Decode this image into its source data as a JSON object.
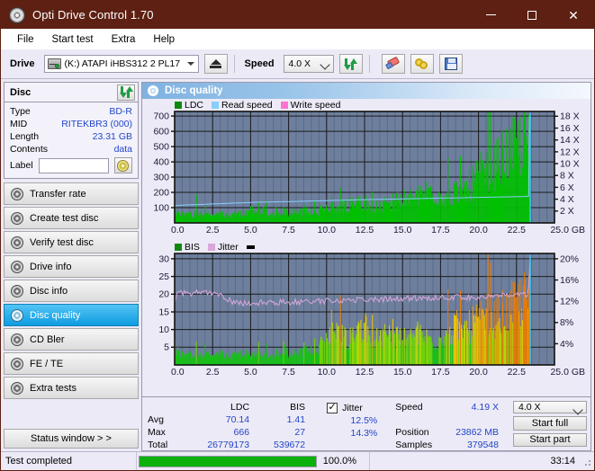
{
  "window": {
    "title": "Opti Drive Control 1.70",
    "icon": "disc-icon",
    "minimize_label": "—",
    "maximize_label": "□",
    "close_label": "✕"
  },
  "menu": {
    "items": [
      {
        "label": "File"
      },
      {
        "label": "Start test"
      },
      {
        "label": "Extra"
      },
      {
        "label": "Help"
      }
    ]
  },
  "toolbar": {
    "drive_label": "Drive",
    "drive_value": "(K:)  ATAPI iHBS312   2 PL17",
    "eject_icon": "eject-icon",
    "speed_label": "Speed",
    "speed_value": "4.0 X",
    "refresh_icon": "refresh-icon",
    "eraser_icon": "eraser-icon",
    "rings_icon": "gold-rings-icon",
    "save_icon": "floppy-save-icon"
  },
  "disc_panel": {
    "title": "Disc",
    "refresh_icon": "refresh-icon",
    "rows": [
      {
        "key": "Type",
        "value": "BD-R"
      },
      {
        "key": "MID",
        "value": "RITEKBR3 (000)"
      },
      {
        "key": "Length",
        "value": "23.31 GB"
      },
      {
        "key": "Contents",
        "value": "data"
      }
    ],
    "label_key": "Label",
    "label_value": "",
    "label_placeholder": "",
    "label_button_icon": "cd-disc-icon"
  },
  "nav": {
    "items": [
      {
        "label": "Transfer rate",
        "icon": "disc-icon",
        "active": false
      },
      {
        "label": "Create test disc",
        "icon": "disc-icon",
        "active": false
      },
      {
        "label": "Verify test disc",
        "icon": "disc-icon",
        "active": false
      },
      {
        "label": "Drive info",
        "icon": "disc-icon",
        "active": false
      },
      {
        "label": "Disc info",
        "icon": "disc-icon",
        "active": false
      },
      {
        "label": "Disc quality",
        "icon": "disc-icon",
        "active": true
      },
      {
        "label": "CD Bler",
        "icon": "disc-icon",
        "active": false
      },
      {
        "label": "FE / TE",
        "icon": "disc-icon",
        "active": false
      },
      {
        "label": "Extra tests",
        "icon": "disc-icon",
        "active": false
      }
    ],
    "status_window_label": "Status window > >"
  },
  "panel": {
    "title": "Disc quality",
    "icon": "disc-icon"
  },
  "stats": {
    "col_headers": [
      "LDC",
      "BIS"
    ],
    "rows": [
      {
        "label": "Avg",
        "ldc": "70.14",
        "bis": "1.41",
        "jitter": "12.5%"
      },
      {
        "label": "Max",
        "ldc": "666",
        "bis": "27",
        "jitter": "14.3%"
      },
      {
        "label": "Total",
        "ldc": "26779173",
        "bis": "539672",
        "jitter": ""
      }
    ],
    "jitter_label": "Jitter",
    "jitter_checked": true,
    "speed_label": "Speed",
    "speed_value": "4.19 X",
    "position_label": "Position",
    "position_value": "23862 MB",
    "samples_label": "Samples",
    "samples_value": "379548",
    "speed_select_value": "4.0 X",
    "start_full_label": "Start full",
    "start_part_label": "Start part"
  },
  "statusbar": {
    "message": "Test completed",
    "percent_label": "100.0%",
    "percent_value": 100,
    "time": "33:14"
  },
  "colors": {
    "titlebar": "#5d2012",
    "accent_blue": "#2346c8",
    "plot_bg": "#6e7f9e",
    "ldc_green": "#00c000",
    "read_speed": "#87cefa",
    "write_speed": "#ff70d0",
    "bis_green": "#00c000",
    "jitter_pink": "#d9a8d9",
    "progress_green": "#0bb00b",
    "nav_active": "#0e9ce0"
  },
  "chart_data": [
    {
      "type": "area",
      "name": "ldc-chart",
      "title": "",
      "xlabel": "GB",
      "ylabel": "",
      "xlim": [
        0,
        25
      ],
      "xticks": [
        "0.0",
        "2.5",
        "5.0",
        "7.5",
        "10.0",
        "12.5",
        "15.0",
        "17.5",
        "20.0",
        "22.5",
        "25.0 GB"
      ],
      "ylim": [
        0,
        730
      ],
      "yticks": [
        100,
        200,
        300,
        400,
        500,
        600,
        700
      ],
      "y2label": "X",
      "y2lim": [
        0,
        18.8
      ],
      "y2ticks": [
        "2 X",
        "4 X",
        "6 X",
        "8 X",
        "10 X",
        "12 X",
        "14 X",
        "16 X",
        "18 X"
      ],
      "grid": true,
      "legend": [
        "LDC",
        "Read speed",
        "Write speed"
      ],
      "legend_position": "top-left",
      "data_end_x": 23.4,
      "series": [
        {
          "name": "LDC",
          "color": "#00c000",
          "kind": "area",
          "x": [
            0.0,
            0.15,
            0.3,
            0.6,
            0.9,
            1.2,
            1.35,
            1.5,
            1.8,
            2.1,
            2.4,
            2.7,
            3.0,
            3.3,
            3.6,
            3.9,
            4.2,
            4.5,
            4.8,
            4.97,
            5.0,
            5.05,
            5.3,
            5.6,
            5.8,
            5.95,
            6.1,
            6.4,
            6.7,
            7.0,
            7.3,
            7.6,
            7.9,
            8.2,
            8.5,
            8.8,
            9.1,
            9.4,
            9.7,
            10.0,
            10.3,
            10.6,
            10.9,
            11.2,
            11.5,
            11.8,
            11.95,
            12.2,
            12.5,
            12.8,
            13.1,
            13.4,
            13.7,
            14.0,
            14.3,
            14.6,
            14.9,
            15.2,
            15.5,
            15.8,
            16.1,
            16.4,
            16.7,
            16.85,
            17.0,
            17.3,
            17.6,
            17.9,
            18.2,
            18.5,
            18.8,
            19.1,
            19.4,
            19.7,
            20.0,
            20.3,
            20.6,
            20.9,
            21.2,
            21.5,
            21.8,
            22.1,
            22.4,
            22.7,
            23.0,
            23.2,
            23.35,
            23.4
          ],
          "values": [
            130,
            75,
            62,
            70,
            66,
            64,
            118,
            72,
            68,
            64,
            66,
            62,
            68,
            64,
            70,
            66,
            72,
            68,
            74,
            120,
            290,
            110,
            78,
            80,
            140,
            86,
            82,
            80,
            78,
            82,
            80,
            84,
            82,
            86,
            88,
            92,
            96,
            100,
            104,
            108,
            112,
            118,
            126,
            132,
            140,
            152,
            168,
            150,
            158,
            150,
            146,
            150,
            152,
            156,
            162,
            170,
            176,
            186,
            196,
            206,
            214,
            236,
            250,
            268,
            240,
            230,
            224,
            216,
            230,
            226,
            246,
            262,
            300,
            340,
            372,
            418,
            392,
            436,
            470,
            506,
            540,
            578,
            600,
            636,
            660,
            666,
            560,
            0
          ]
        },
        {
          "name": "Read speed",
          "color": "#87cefa",
          "kind": "line",
          "x": [
            0.0,
            0.5,
            1.0,
            1.5,
            2.0,
            2.5,
            3.0,
            3.5,
            4.0,
            4.5,
            5.0,
            5.5,
            6.0,
            6.5,
            7.0,
            7.5,
            8.0,
            8.5,
            9.0,
            9.5,
            10.0,
            10.5,
            11.0,
            11.5,
            12.0,
            12.5,
            13.0,
            13.5,
            14.0,
            14.5,
            15.0,
            15.5,
            16.0,
            16.5,
            17.0,
            17.5,
            18.0,
            18.5,
            19.0,
            19.5,
            20.0,
            20.5,
            21.0,
            21.5,
            22.0,
            22.5,
            23.0,
            23.3,
            23.35
          ],
          "values": [
            2.9,
            3.0,
            3.05,
            3.1,
            3.15,
            3.2,
            3.25,
            3.3,
            3.35,
            3.4,
            3.45,
            3.5,
            3.52,
            3.55,
            3.58,
            3.6,
            3.63,
            3.66,
            3.7,
            3.72,
            3.76,
            3.8,
            3.82,
            3.86,
            3.9,
            3.92,
            3.95,
            3.98,
            4.0,
            4.02,
            4.05,
            4.08,
            4.1,
            4.12,
            4.15,
            4.18,
            4.2,
            4.22,
            4.25,
            4.28,
            4.3,
            4.32,
            4.35,
            4.38,
            4.4,
            4.42,
            4.45,
            4.5,
            17.9
          ],
          "axis": "y2"
        },
        {
          "name": "Write speed",
          "color": "#ff70d0",
          "kind": "line",
          "x": [],
          "values": []
        }
      ]
    },
    {
      "type": "area",
      "name": "bis-jitter-chart",
      "title": "",
      "xlabel": "GB",
      "ylabel": "",
      "xlim": [
        0,
        25
      ],
      "xticks": [
        "0.0",
        "2.5",
        "5.0",
        "7.5",
        "10.0",
        "12.5",
        "15.0",
        "17.5",
        "20.0",
        "22.5",
        "25.0 GB"
      ],
      "ylim": [
        0,
        31.5
      ],
      "yticks": [
        5,
        10,
        15,
        20,
        25,
        30
      ],
      "y2label": "%",
      "y2lim": [
        0,
        21
      ],
      "y2ticks": [
        "4%",
        "8%",
        "12%",
        "16%",
        "20%"
      ],
      "grid": true,
      "legend": [
        "BIS",
        "Jitter"
      ],
      "legend_position": "top-left",
      "data_end_x": 23.4,
      "series": [
        {
          "name": "BIS",
          "color": "#00c000",
          "kind": "area",
          "x": [
            0.0,
            0.15,
            0.3,
            0.6,
            0.9,
            1.2,
            1.5,
            1.8,
            2.1,
            2.4,
            2.7,
            3.0,
            3.3,
            3.6,
            3.9,
            4.2,
            4.5,
            4.8,
            5.0,
            5.3,
            5.6,
            5.9,
            6.2,
            6.5,
            6.8,
            7.1,
            7.4,
            7.7,
            8.0,
            8.3,
            8.6,
            8.9,
            9.2,
            9.5,
            9.8,
            10.1,
            10.4,
            10.7,
            11.0,
            11.3,
            11.6,
            11.9,
            12.2,
            12.5,
            12.8,
            13.1,
            13.4,
            13.7,
            14.0,
            14.3,
            14.6,
            14.9,
            15.2,
            15.5,
            15.8,
            16.1,
            16.4,
            16.7,
            17.0,
            17.3,
            17.6,
            17.9,
            18.2,
            18.5,
            18.8,
            19.1,
            19.4,
            19.7,
            20.0,
            20.3,
            20.6,
            20.9,
            21.2,
            21.5,
            21.8,
            22.1,
            22.4,
            22.7,
            23.0,
            23.2,
            23.35,
            23.4
          ],
          "values": [
            7.0,
            4.5,
            3.4,
            3.6,
            3.2,
            4.0,
            3.4,
            3.2,
            3.6,
            3.4,
            3.2,
            3.6,
            3.4,
            3.2,
            3.6,
            3.4,
            3.8,
            3.4,
            3.2,
            3.6,
            4.0,
            3.4,
            3.8,
            3.4,
            3.6,
            5.2,
            4.0,
            3.6,
            4.0,
            4.4,
            4.6,
            5.6,
            5.0,
            6.6,
            7.6,
            8.6,
            10.2,
            13.0,
            9.4,
            8.6,
            9.0,
            10.4,
            11.8,
            12.6,
            11.0,
            10.0,
            11.0,
            10.6,
            9.8,
            11.2,
            9.0,
            10.0,
            8.6,
            9.0,
            10.6,
            10.4,
            9.2,
            9.0,
            8.4,
            8.6,
            9.6,
            11.0,
            10.6,
            13.4,
            11.6,
            12.0,
            13.0,
            15.0,
            14.6,
            16.0,
            17.6,
            15.6,
            16.6,
            18.0,
            17.4,
            19.4,
            20.6,
            22.0,
            22.8,
            23.6,
            20.0,
            0
          ],
          "note": "bars shade green→yellow→orange with increasing magnitude"
        },
        {
          "name": "Jitter",
          "color": "#d9a8d9",
          "kind": "line",
          "x": [
            0.0,
            0.2,
            0.4,
            0.7,
            1.0,
            1.3,
            1.6,
            1.9,
            2.2,
            2.5,
            2.8,
            3.1,
            3.4,
            3.6,
            3.8,
            4.0,
            4.3,
            4.6,
            5.0,
            5.5,
            6.0,
            6.5,
            7.0,
            7.5,
            8.0,
            8.5,
            9.0,
            9.5,
            10.0,
            10.5,
            11.0,
            11.5,
            12.0,
            12.5,
            13.0,
            13.5,
            14.0,
            14.5,
            15.0,
            15.5,
            16.0,
            16.5,
            17.0,
            17.5,
            18.0,
            18.5,
            19.0,
            19.5,
            20.0,
            20.5,
            21.0,
            21.5,
            22.0,
            22.5,
            23.0,
            23.3,
            23.35
          ],
          "values": [
            12.0,
            13.5,
            13.4,
            13.6,
            13.4,
            13.8,
            13.5,
            13.4,
            13.6,
            13.3,
            13.2,
            13.0,
            12.6,
            12.2,
            11.9,
            11.8,
            11.7,
            11.6,
            11.7,
            11.7,
            11.8,
            11.7,
            11.8,
            11.8,
            11.9,
            11.9,
            12.0,
            12.0,
            12.1,
            12.1,
            12.2,
            12.2,
            12.3,
            12.3,
            12.3,
            12.4,
            12.4,
            12.4,
            12.5,
            12.5,
            12.6,
            12.6,
            12.6,
            12.7,
            12.8,
            12.8,
            12.7,
            12.7,
            12.8,
            12.9,
            12.9,
            13.0,
            13.0,
            13.1,
            13.2,
            13.4,
            20.0
          ],
          "axis": "y2"
        }
      ]
    }
  ]
}
